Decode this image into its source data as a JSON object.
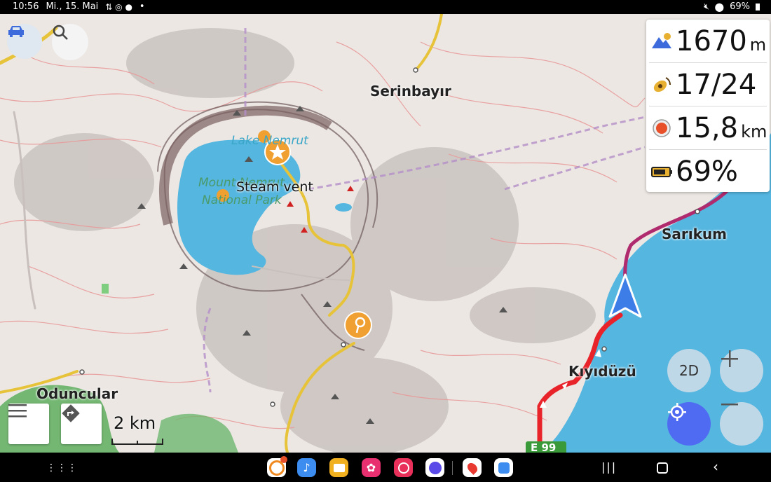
{
  "status_bar": {
    "time": "10:56",
    "date": "Mi., 15. Mai",
    "battery": "69%"
  },
  "map": {
    "labels": {
      "serinbayir": "Serinbayır",
      "lake": "Lake Nemrut",
      "park_line1": "Mount Nemrut",
      "park_line2": "National Park",
      "steam_vent": "Steam vent",
      "sarikum": "Sarıkum",
      "kiyiduzu": "Kıyıdüzü",
      "oduncular": "Oduncular",
      "road_shield": "E 99"
    },
    "scale_label": "2 km"
  },
  "widgets": {
    "altitude": {
      "value": "1670",
      "unit": "m",
      "icon": "altitude-icon"
    },
    "gps": {
      "value": "17/24",
      "icon": "satellite-icon"
    },
    "distance": {
      "value": "15,8",
      "unit": "km",
      "icon": "distance-icon"
    },
    "battery": {
      "value": "69%",
      "icon": "battery-icon"
    }
  },
  "controls": {
    "mode_label": "2D"
  },
  "colors": {
    "accent_blue": "#4f6bf2",
    "route_red": "#e8232a",
    "road_yellow": "#e7c33a",
    "water": "#55b6e0"
  }
}
